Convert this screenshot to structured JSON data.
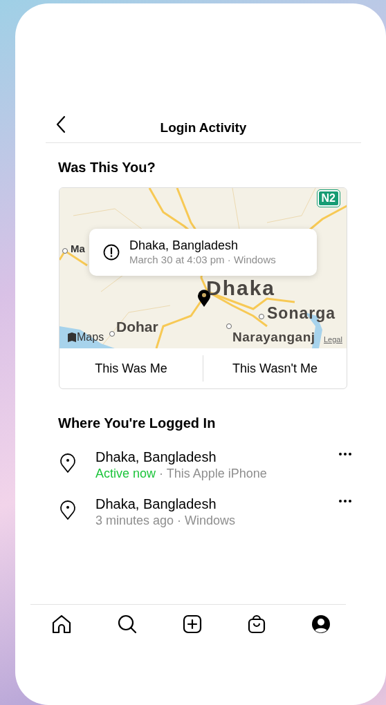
{
  "header": {
    "title": "Login Activity"
  },
  "alert": {
    "heading": "Was This You?",
    "map_labels": [
      "Ma",
      "Dhaka",
      "Sonarga",
      "Dohar",
      "Narayanganj"
    ],
    "map_attribution": "Maps",
    "map_legal": "Legal",
    "road_sign": "N2",
    "popup": {
      "location": "Dhaka, Bangladesh",
      "detail": "March 30 at 4:03 pm · Windows"
    },
    "actions": [
      "This Was Me",
      "This Wasn't Me"
    ]
  },
  "sessions": {
    "heading": "Where You're Logged In",
    "items": [
      {
        "location": "Dhaka, Bangladesh",
        "status": "Active now",
        "active": true,
        "device": "· This Apple iPhone"
      },
      {
        "location": "Dhaka, Bangladesh",
        "status": "3 minutes ago",
        "active": false,
        "device": "· Windows"
      }
    ]
  }
}
